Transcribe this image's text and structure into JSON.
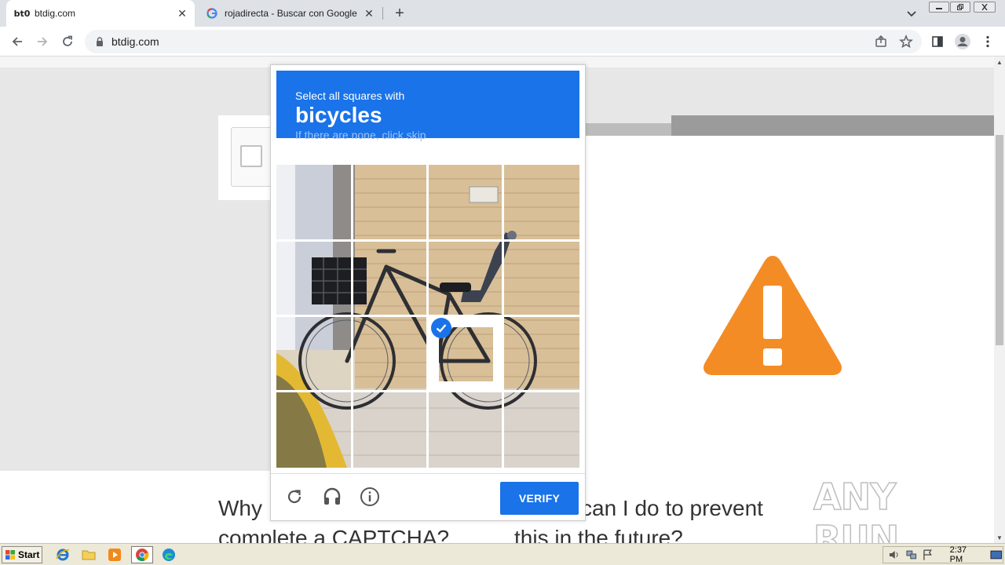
{
  "browser": {
    "tabs": [
      {
        "title": "btdig.com",
        "favicon": "bt-logo-icon",
        "active": true
      },
      {
        "title": "rojadirecta - Buscar con Google",
        "favicon": "google-g-icon",
        "active": false
      }
    ],
    "favicon_text": "bt0",
    "url": "btdig.com"
  },
  "page": {
    "why_line1": "Why",
    "why_line2": "complete a CAPTCHA?",
    "can_line1": "can I do to prevent",
    "can_line2": "this in the future?",
    "warning_icon": "warning-triangle-icon",
    "warning_color": "#f48c25"
  },
  "captcha": {
    "instruction": "Select all squares with",
    "target": "bicycles",
    "hint": "If there are none, click skip",
    "verify_label": "VERIFY",
    "accent": "#1a73e8",
    "selected_tiles": [
      10
    ],
    "footer_icons": [
      "reload-icon",
      "audio-icon",
      "info-icon"
    ]
  },
  "watermark": {
    "text": "ANY RUN"
  },
  "taskbar": {
    "start_label": "Start",
    "clock": "2:37 PM",
    "apps": [
      "internet-explorer-icon",
      "folder-icon",
      "media-player-icon",
      "chrome-icon",
      "edge-icon"
    ]
  }
}
